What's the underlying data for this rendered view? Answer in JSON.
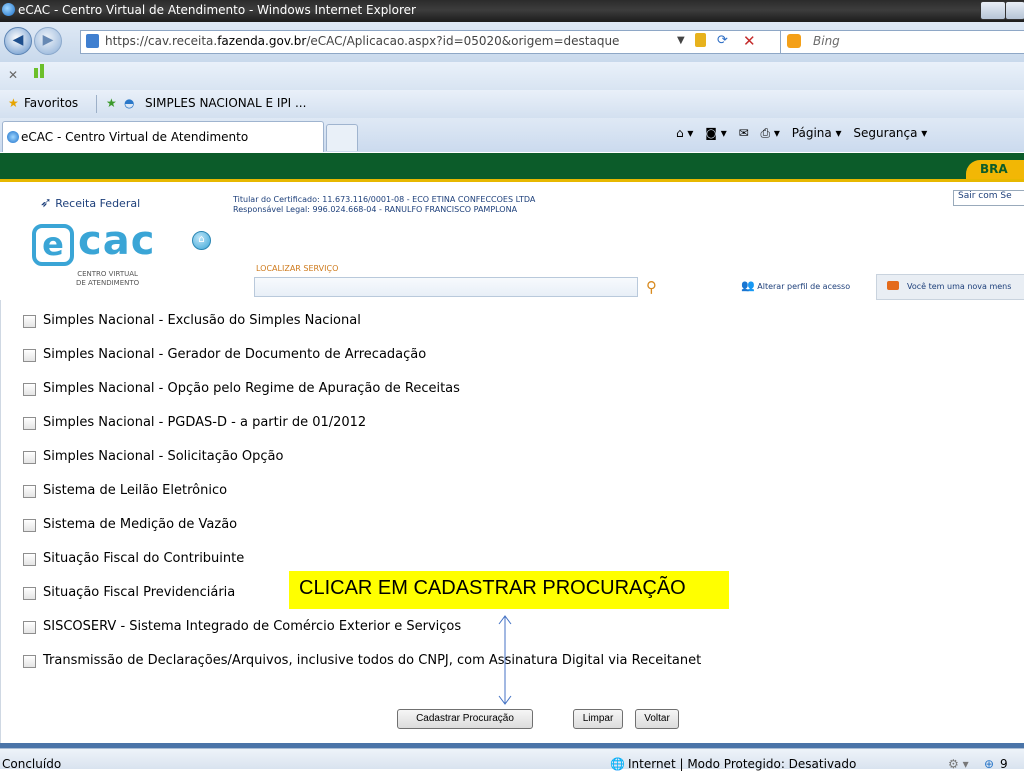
{
  "window": {
    "title": "eCAC - Centro Virtual de Atendimento - Windows Internet Explorer"
  },
  "address": {
    "url_prefix": "https://cav.receita.",
    "url_domain": "fazenda.gov.br",
    "url_suffix": "/eCAC/Aplicacao.aspx?id=05020&origem=destaque",
    "search_engine": "Bing"
  },
  "favorites": {
    "label": "Favoritos",
    "item": "SIMPLES NACIONAL E IPI ..."
  },
  "tabs": {
    "active": "eCAC - Centro Virtual de Atendimento"
  },
  "command_bar": {
    "page": "Página ▾",
    "security": "Segurança ▾"
  },
  "header": {
    "brand_tag": "BRA",
    "rf_logo": "Receita Federal",
    "cert_line1": "Titular do Certificado: 11.673.116/0001-08 - ECO ETINA CONFECCOES LTDA",
    "cert_line2": "Responsável Legal: 996.024.668-04 - RANULFO FRANCISCO PAMPLONA",
    "logout": "Sair com Se",
    "logo_main": "cac",
    "logo_e": "e",
    "logo_sub1": "CENTRO VIRTUAL",
    "logo_sub2": "DE ATENDIMENTO",
    "search_label": "LOCALIZAR SERVIÇO",
    "alter_profile": "Alterar perfil de acesso",
    "message": "Você tem uma nova mens"
  },
  "services": [
    "Simples Nacional - Exclusão do Simples Nacional",
    "Simples Nacional - Gerador de Documento de Arrecadação",
    "Simples Nacional - Opção pelo Regime de Apuração de Receitas",
    "Simples Nacional - PGDAS-D - a partir de 01/2012",
    "Simples Nacional - Solicitação Opção",
    "Sistema de Leilão Eletrônico",
    "Sistema de Medição de Vazão",
    "Situação Fiscal do Contribuinte",
    "Situação Fiscal Previdenciária",
    "SISCOSERV - Sistema Integrado de Comércio Exterior e Serviços",
    "Transmissão de Declarações/Arquivos, inclusive todos do CNPJ, com Assinatura Digital via Receitanet"
  ],
  "callout": "CLICAR EM CADASTRAR PROCURAÇÃO",
  "buttons": {
    "register": "Cadastrar Procuração",
    "clear": "Limpar",
    "back": "Voltar"
  },
  "status": {
    "left": "Concluído",
    "zone": "Internet | Modo Protegido: Desativado",
    "zoom": "9"
  }
}
